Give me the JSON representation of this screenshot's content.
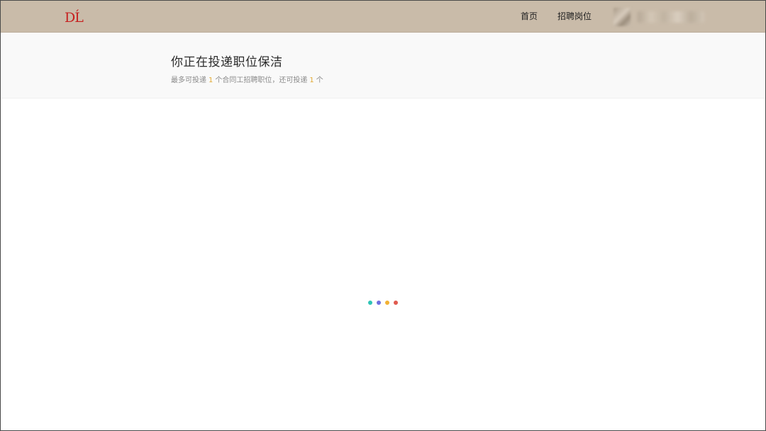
{
  "nav": {
    "logo_text": "DĹ",
    "home_label": "首页",
    "jobs_label": "招聘岗位",
    "user": {
      "avatar_icon": "blurred-avatar",
      "name": ""
    }
  },
  "header": {
    "title": "你正在投递职位保洁",
    "quota": {
      "prefix": "最多可投递",
      "max_count": "1",
      "middle": "个合同工招聘职位，还可投递",
      "remaining_count": "1",
      "suffix": "个"
    }
  },
  "loader": {
    "dots": [
      {
        "color": "#2ec4b6"
      },
      {
        "color": "#6f6fe0"
      },
      {
        "color": "#f2b134"
      },
      {
        "color": "#e05a4f"
      }
    ]
  },
  "colors": {
    "topbar": "#c9bba9",
    "logo": "#c6201f",
    "accent_number": "#e2a935"
  }
}
